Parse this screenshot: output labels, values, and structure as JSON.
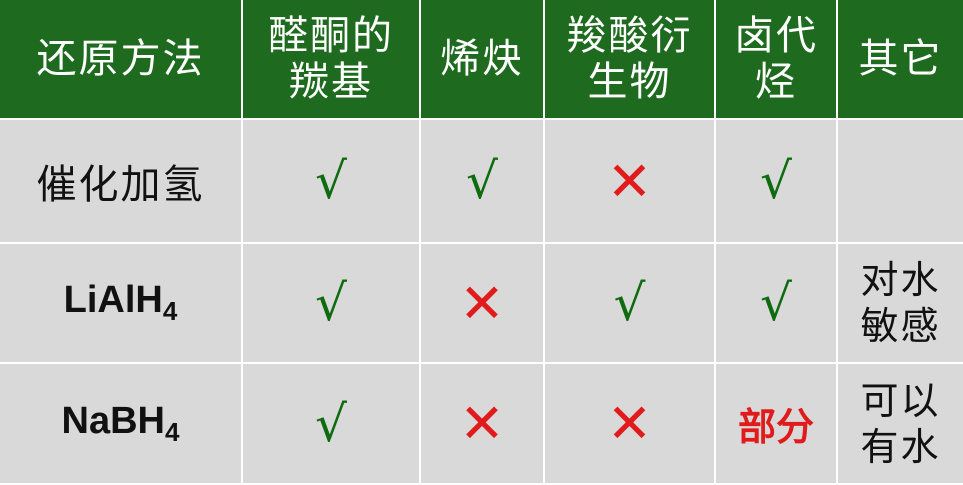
{
  "headers": [
    {
      "line1": "还原方法",
      "line2": ""
    },
    {
      "line1": "醛酮的",
      "line2": "羰基"
    },
    {
      "line1": "烯炔",
      "line2": ""
    },
    {
      "line1": "羧酸衍",
      "line2": "生物"
    },
    {
      "line1": "卤代",
      "line2": "烃"
    },
    {
      "line1": "其它",
      "line2": ""
    }
  ],
  "rows": [
    {
      "method": "催化加氢",
      "cells": [
        "check",
        "check",
        "cross",
        "check"
      ],
      "note_line1": "",
      "note_line2": ""
    },
    {
      "method_base": "LiAlH",
      "method_sub": "4",
      "cells": [
        "check",
        "cross",
        "check",
        "check"
      ],
      "note_line1": "对水",
      "note_line2": "敏感"
    },
    {
      "method_base": "NaBH",
      "method_sub": "4",
      "cells": [
        "check",
        "cross",
        "cross",
        "partial"
      ],
      "partial_label": "部分",
      "note_line1": "可以",
      "note_line2": "有水"
    }
  ],
  "symbols": {
    "check": "√",
    "cross": "✕"
  },
  "colors": {
    "header_bg": "#1e6a1e",
    "body_bg": "#d9d9d9",
    "check": "#0f6b0f",
    "cross": "#e11b1b"
  }
}
